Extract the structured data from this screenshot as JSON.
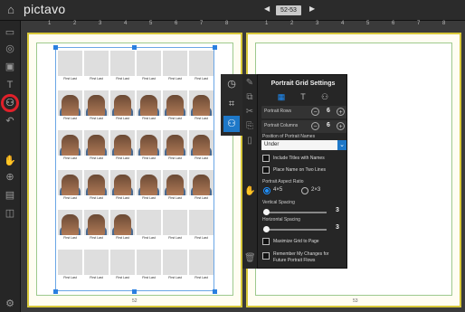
{
  "app": {
    "brand": "pictavo"
  },
  "nav": {
    "page_indicator": "52-53",
    "prev_icon": "triangle-left-icon",
    "next_icon": "triangle-right-icon"
  },
  "ruler": {
    "numbers": [
      "1",
      "2",
      "3",
      "4",
      "5",
      "6",
      "7",
      "8",
      "1",
      "2",
      "3",
      "4",
      "5",
      "6",
      "7",
      "8"
    ]
  },
  "pages": {
    "left_number": "52",
    "right_number": "53"
  },
  "portrait_grid": {
    "name_label": "First Last",
    "rows": 6,
    "columns": 6
  },
  "panel": {
    "title": "Portrait Grid Settings",
    "portrait_rows_label": "Portrait Rows",
    "portrait_rows_value": "6",
    "portrait_columns_label": "Portrait Columns",
    "portrait_columns_value": "6",
    "position_names_label": "Position of Portrait Names",
    "position_names_value": "Under",
    "include_titles_label": "Include Titles with Names",
    "two_lines_label": "Place Name on Two Lines",
    "aspect_ratio_label": "Portrait Aspect Ratio",
    "aspect_45": "4×5",
    "aspect_23": "2×3",
    "vertical_spacing_label": "Vertical Spacing",
    "vertical_spacing_value": "3",
    "horizontal_spacing_label": "Horizontal Spacing",
    "horizontal_spacing_value": "3",
    "maximize_label": "Maximize Grid to Page",
    "remember_label_1": "Remember My Changes for",
    "remember_label_2": "Future Portrait Flows"
  },
  "colors": {
    "accent": "#1e78c8",
    "highlight_ring": "#e0202a",
    "page_border": "#d8c83a",
    "selection": "#2a7fe0"
  }
}
